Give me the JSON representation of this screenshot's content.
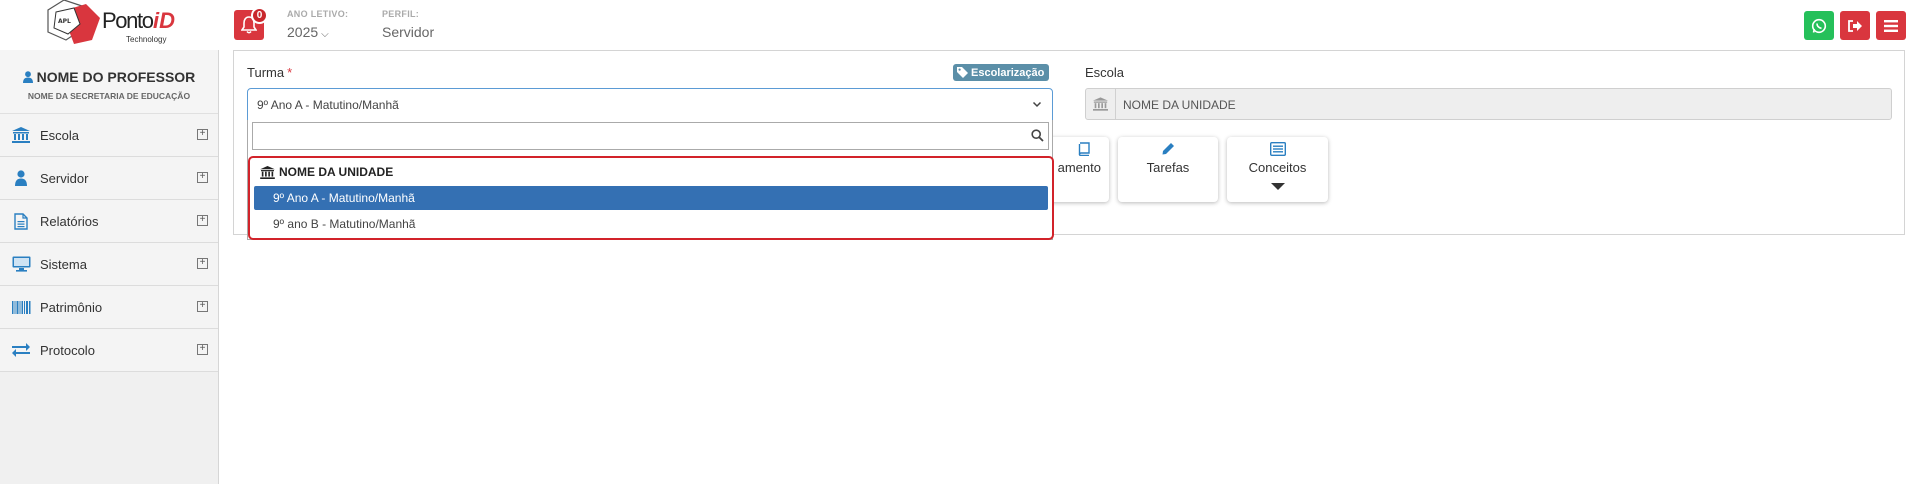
{
  "header": {
    "logo": {
      "name": "PontoiD",
      "sub": "Technology",
      "mark": "APL"
    },
    "notifications": {
      "count": "0"
    },
    "ano_letivo": {
      "label": "ANO LETIVO:",
      "value": "2025"
    },
    "perfil": {
      "label": "PERFIL:",
      "value": "Servidor"
    },
    "colors": {
      "whatsapp": "#25c05a",
      "logout": "#d9363e",
      "menu": "#d9363e"
    }
  },
  "sidebar": {
    "professor_name": "NOME DO PROFESSOR",
    "secretaria": "NOME DA SECRETARIA DE EDUCAÇÃO",
    "items": [
      {
        "label": "Escola",
        "icon": "bank-icon"
      },
      {
        "label": "Servidor",
        "icon": "user-icon"
      },
      {
        "label": "Relatórios",
        "icon": "file-icon"
      },
      {
        "label": "Sistema",
        "icon": "desktop-icon"
      },
      {
        "label": "Patrimônio",
        "icon": "barcode-icon"
      },
      {
        "label": "Protocolo",
        "icon": "exchange-icon"
      }
    ],
    "expand_glyph": "+"
  },
  "form": {
    "turma_label": "Turma",
    "required_mark": "*",
    "escolarizacao_badge": "Escolarização",
    "turma_selected": "9º Ano A - Matutino/Manhã",
    "escola_label": "Escola",
    "escola_value": "NOME DA UNIDADE"
  },
  "dropdown": {
    "search_value": "",
    "group_label": "NOME DA UNIDADE",
    "options": [
      "9º Ano A - Matutino/Manhã",
      "9º ano B - Matutino/Manhã"
    ]
  },
  "cards": {
    "partial_label": "amento",
    "tarefas": "Tarefas",
    "conceitos": "Conceitos"
  }
}
